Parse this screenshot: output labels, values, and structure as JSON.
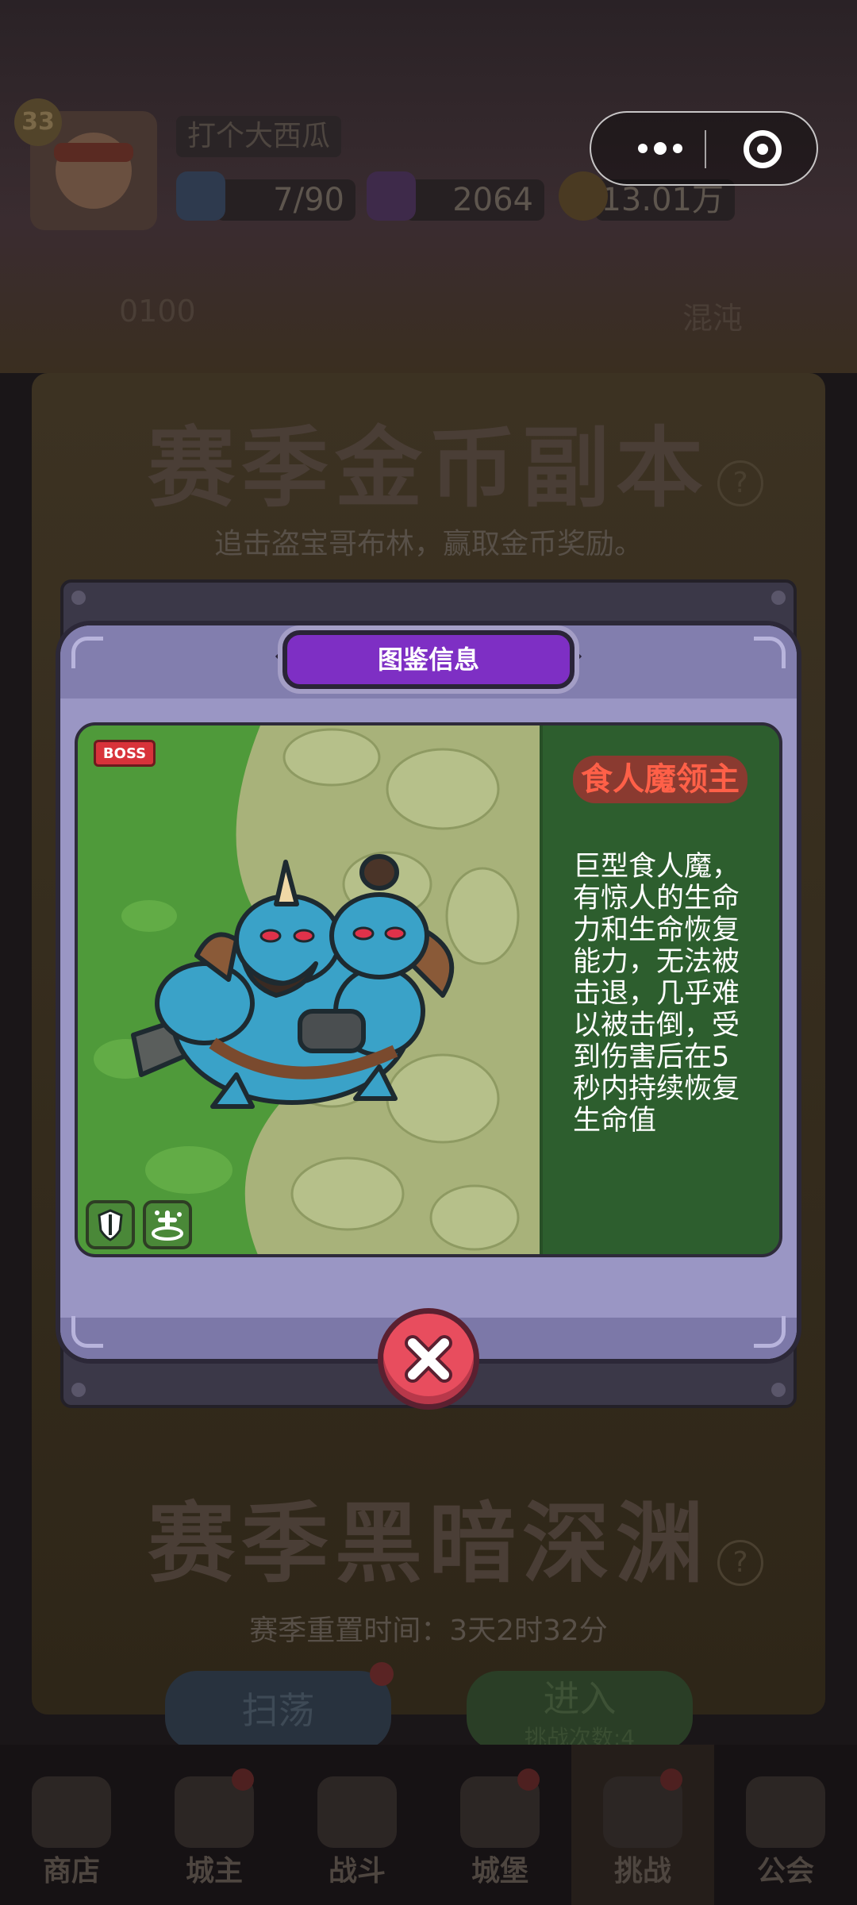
{
  "background": {
    "player": {
      "level": "33",
      "name": "打个大西瓜"
    },
    "resources": [
      {
        "icon": "lightning-energy-icon",
        "value": "7/90"
      },
      {
        "icon": "purple-gem-icon",
        "value": "2064"
      },
      {
        "icon": "gold-coin-icon",
        "value": "13.01万"
      }
    ],
    "side_labels": [
      "0100",
      "混沌"
    ],
    "dungeon_gold": {
      "title": "赛季金币副本",
      "subtitle": "追击盗宝哥布林，赢取金币奖励。"
    },
    "dungeon_abyss": {
      "title": "赛季黑暗深渊",
      "reset_time": "赛季重置时间：3天2时32分",
      "sweep_label": "扫荡",
      "enter_label": "进入",
      "challenge_count": "挑战次数:4"
    },
    "nav": [
      {
        "label": "商店",
        "icon": "shop-icon",
        "badge": false,
        "active": false
      },
      {
        "label": "城主",
        "icon": "crown-icon",
        "badge": true,
        "active": false
      },
      {
        "label": "战斗",
        "icon": "crossed-swords-icon",
        "badge": false,
        "active": false
      },
      {
        "label": "城堡",
        "icon": "castle-icon",
        "badge": true,
        "active": false
      },
      {
        "label": "挑战",
        "icon": "skull-icon",
        "badge": true,
        "active": true
      },
      {
        "label": "公会",
        "icon": "guild-banner-icon",
        "badge": false,
        "active": false
      }
    ]
  },
  "modal": {
    "title": "图鉴信息",
    "boss_badge": "BOSS",
    "enemy_name": "食人魔领主",
    "description": "巨型食人魔，有惊人的生命力和生命恢复能力，无法被击退，几乎难以被击倒，受到伤害后在5秒内持续恢复生命值",
    "abilities": [
      "shield-ability-icon",
      "heal-ability-icon"
    ]
  },
  "colors": {
    "title_ribbon": "#7e2fc4",
    "panel": "#9a96c4",
    "name_text": "#ff6048",
    "close_button": "#e84d5e"
  }
}
